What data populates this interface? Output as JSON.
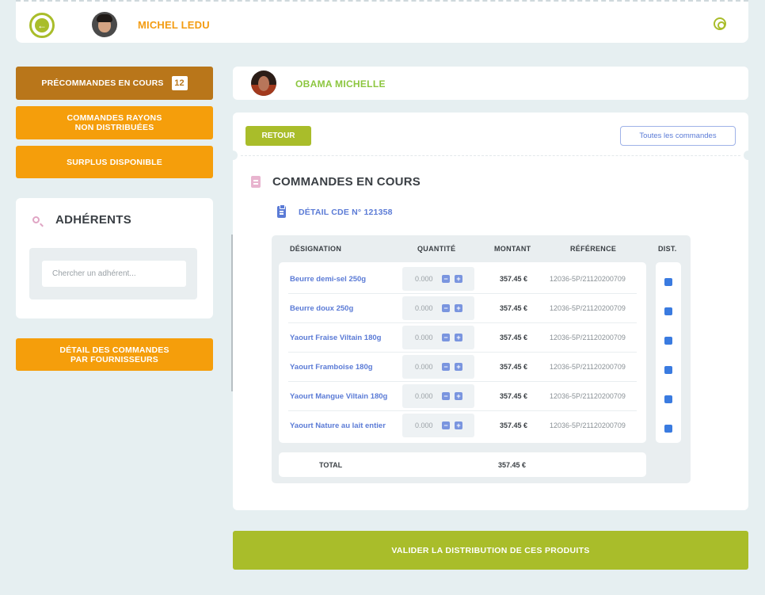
{
  "header": {
    "user_name": "MICHEL LEDU"
  },
  "sidebar": {
    "precommandes_label": "PRÉCOMMANDES EN COURS",
    "precommandes_count": "12",
    "rayons_line1": "COMMANDES RAYONS",
    "rayons_line2": "NON DISTRIBUÉES",
    "surplus_label": "SURPLUS DISPONIBLE",
    "adherents_title": "ADHÉRENTS",
    "adherents_search_placeholder": "Chercher un adhérent...",
    "detail_line1": "DÉTAIL DES COMMANDES",
    "detail_line2": "PAR FOURNISSEURS"
  },
  "client": {
    "name": "OBAMA MICHELLE"
  },
  "main": {
    "retour_label": "RETOUR",
    "toutes_label": "Toutes les commandes",
    "section_title": "COMMANDES EN COURS",
    "order_title": "DÉTAIL CDE N° 121358",
    "columns": {
      "designation": "DÉSIGNATION",
      "quantite": "QUANTITÉ",
      "montant": "MONTANT",
      "reference": "RÉFÉRENCE",
      "dist": "DIST."
    },
    "rows": [
      {
        "designation": "Beurre demi-sel 250g",
        "quantite": "0.000",
        "montant": "357.45 €",
        "reference": "12036-5P/21120200709",
        "dist": true
      },
      {
        "designation": "Beurre doux 250g",
        "quantite": "0.000",
        "montant": "357.45 €",
        "reference": "12036-5P/21120200709",
        "dist": true
      },
      {
        "designation": "Yaourt Fraise Viltain 180g",
        "quantite": "0.000",
        "montant": "357.45 €",
        "reference": "12036-5P/21120200709",
        "dist": true
      },
      {
        "designation": "Yaourt Framboise 180g",
        "quantite": "0.000",
        "montant": "357.45 €",
        "reference": "12036-5P/21120200709",
        "dist": true
      },
      {
        "designation": "Yaourt Mangue Viltain 180g",
        "quantite": "0.000",
        "montant": "357.45 €",
        "reference": "12036-5P/21120200709",
        "dist": true
      },
      {
        "designation": "Yaourt Nature au lait entier",
        "quantite": "0.000",
        "montant": "357.45 €",
        "reference": "12036-5P/21120200709",
        "dist": true
      }
    ],
    "total_label": "TOTAL",
    "total_value": "357.45 €"
  },
  "footer": {
    "valider_label": "VALIDER LA DISTRIBUTION DE CES PRODUITS"
  },
  "colors": {
    "orange": "#f59e0b",
    "orange_active": "#b9761a",
    "green": "#a9bd2a",
    "blue": "#5b7bd6"
  }
}
